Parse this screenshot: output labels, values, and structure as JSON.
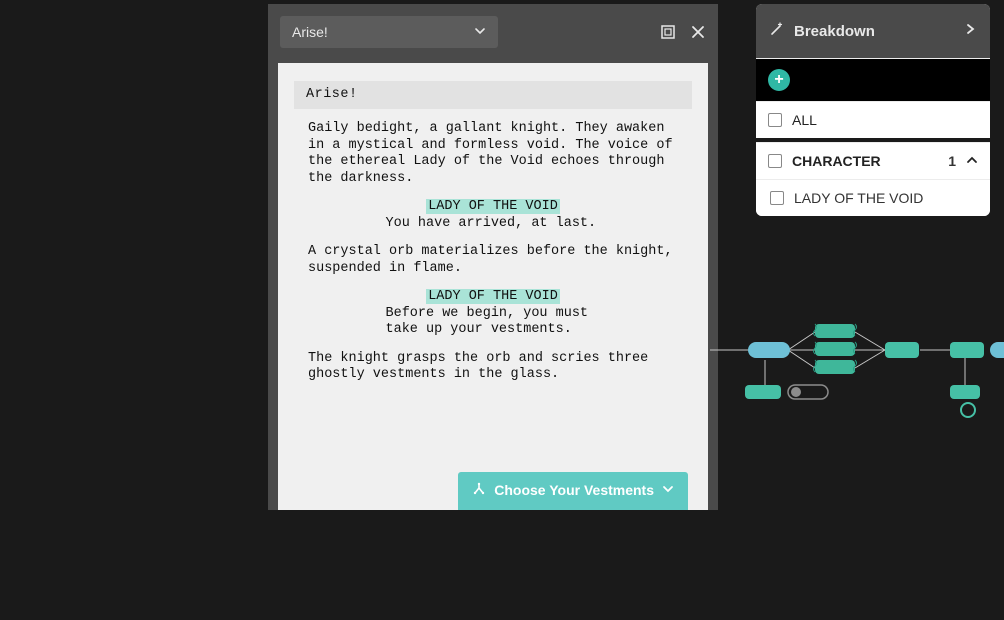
{
  "editor": {
    "selector_label": "Arise!",
    "title": "Arise!",
    "action1": "Gaily bedight, a gallant knight. They awaken in a mystical and formless void. The voice of the ethereal Lady of the Void echoes through the darkness.",
    "char1": "LADY OF THE VOID",
    "dial1": "You have arrived, at last.",
    "action2": "A crystal orb materializes before the knight, suspended in flame.",
    "char2": "LADY OF THE VOID",
    "dial2": "Before we begin, you must take up your vestments.",
    "action3": "The knight grasps the orb and scries three ghostly vestments in the glass.",
    "choose_label": "Choose Your Vestments"
  },
  "breakdown": {
    "title": "Breakdown",
    "all_label": "ALL",
    "category_label": "CHARACTER",
    "category_count": "1",
    "item1": "LADY OF THE VOID"
  }
}
